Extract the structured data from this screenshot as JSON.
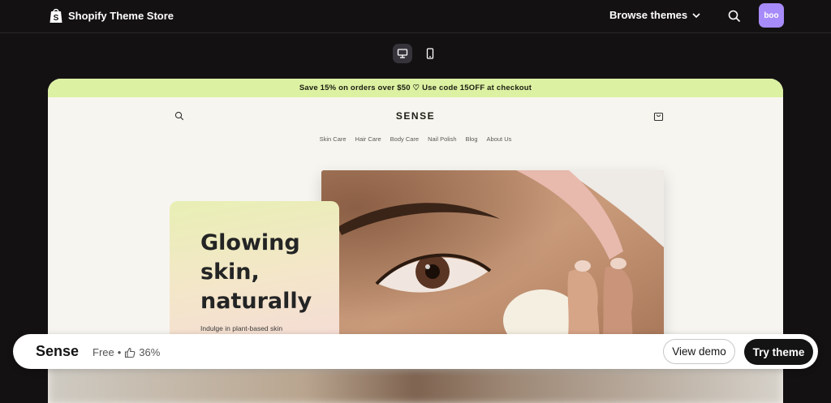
{
  "header": {
    "logo_text": "Shopify Theme Store",
    "browse_label": "Browse themes",
    "avatar_text": "boo"
  },
  "preview": {
    "announcement": "Save 15% on orders over $50 ♡ Use code 15OFF at checkout",
    "brand": "SENSE",
    "nav": [
      "Skin Care",
      "Hair Care",
      "Body Care",
      "Nail Polish",
      "Blog",
      "About Us"
    ],
    "hero_title": "Glowing skin, naturally",
    "hero_subtitle": "Indulge in plant-based skin"
  },
  "bottom_bar": {
    "theme_name": "Sense",
    "price": "Free",
    "separator": "•",
    "rating": "36%",
    "view_demo_label": "View demo",
    "try_theme_label": "Try theme"
  },
  "colors": {
    "page_bg": "#141113",
    "announcement_bg": "#dcf1a2",
    "preview_bg": "#f7f5f0",
    "avatar_bg": "#a78bfa",
    "primary_button": "#141414"
  }
}
